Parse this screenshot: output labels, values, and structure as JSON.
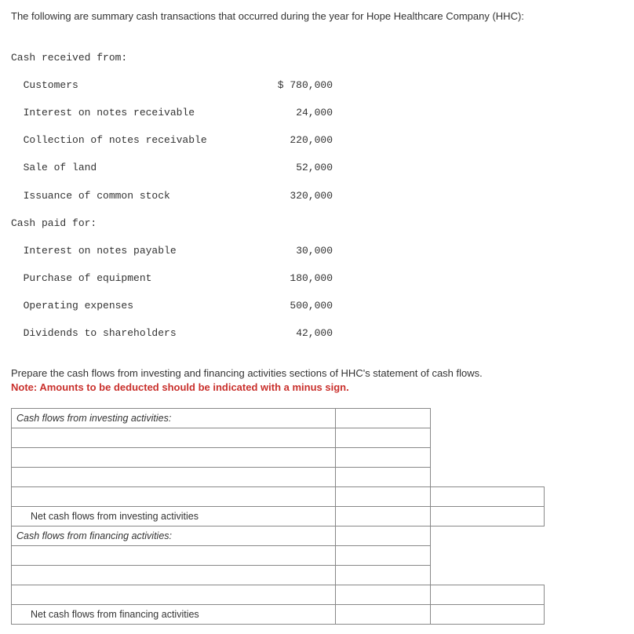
{
  "intro": "The following are summary cash transactions that occurred during the year for Hope Healthcare Company (HHC):",
  "mono": {
    "hdr_received": "Cash received from:",
    "r1_label": "  Customers",
    "r1_val": "$ 780,000",
    "r2_label": "  Interest on notes receivable",
    "r2_val": "24,000",
    "r3_label": "  Collection of notes receivable",
    "r3_val": "220,000",
    "r4_label": "  Sale of land",
    "r4_val": "52,000",
    "r5_label": "  Issuance of common stock",
    "r5_val": "320,000",
    "hdr_paid": "Cash paid for:",
    "p1_label": "  Interest on notes payable",
    "p1_val": "30,000",
    "p2_label": "  Purchase of equipment",
    "p2_val": "180,000",
    "p3_label": "  Operating expenses",
    "p3_val": "500,000",
    "p4_label": "  Dividends to shareholders",
    "p4_val": "42,000"
  },
  "instr_text": "Prepare the cash flows from investing and financing activities sections of HHC's statement of cash flows.",
  "note_text": "Note: Amounts to be deducted should be indicated with a minus sign.",
  "table": {
    "inv_header": "Cash flows from investing activities:",
    "inv_net": "Net cash flows from investing activities",
    "fin_header": "Cash flows from financing activities:",
    "fin_net": "Net cash flows from financing activities"
  }
}
